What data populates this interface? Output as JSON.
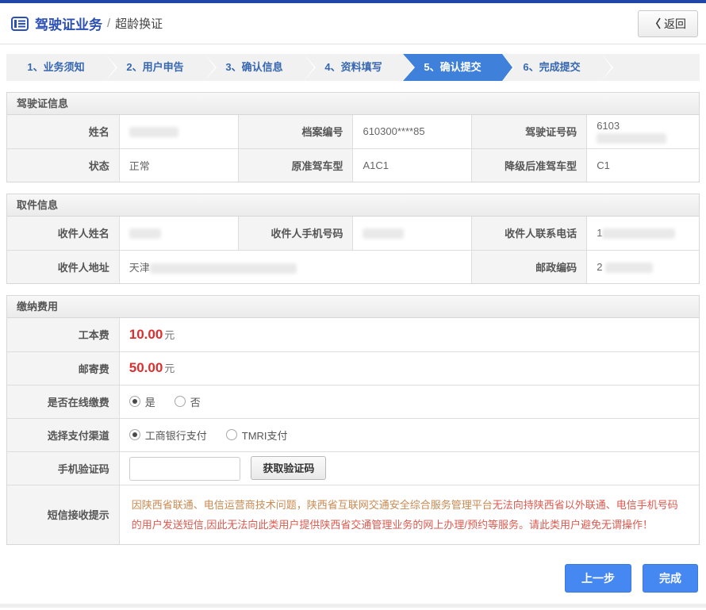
{
  "colors": {
    "top_bar_navy": "#2246a8",
    "accent_blue": "#3f80da",
    "step_text_blue": "#3767b1",
    "fee_red": "#dd2f2f",
    "notice_orange": "#c98a52",
    "notice_red": "#dc5a50",
    "button_blue": "#4688f1"
  },
  "header": {
    "title": "驾驶证业务",
    "separator": "/",
    "subtitle": "超龄换证",
    "back_chevron": "〈",
    "back_label": "返回"
  },
  "steps": [
    {
      "label": "1、业务须知",
      "active": false
    },
    {
      "label": "2、用户申告",
      "active": false
    },
    {
      "label": "3、确认信息",
      "active": false
    },
    {
      "label": "4、资料填写",
      "active": false
    },
    {
      "label": "5、确认提交",
      "active": true
    },
    {
      "label": "6、完成提交",
      "active": false
    }
  ],
  "license": {
    "title": "驾驶证信息",
    "name_label": "姓名",
    "file_no_label": "档案编号",
    "file_no_value": "610300****85",
    "license_no_label": "驾驶证号码",
    "license_no_value": "6103",
    "status_label": "状态",
    "status_value": "正常",
    "orig_class_label": "原准驾车型",
    "orig_class_value": "A1C1",
    "downgraded_class_label": "降级后准驾车型",
    "downgraded_class_value": "C1"
  },
  "pickup": {
    "title": "取件信息",
    "recipient_name_label": "收件人姓名",
    "recipient_mobile_label": "收件人手机号码",
    "recipient_phone_label": "收件人联系电话",
    "recipient_phone_value": "1",
    "recipient_address_label": "收件人地址",
    "recipient_address_value": "天津",
    "postal_code_label": "邮政编码",
    "postal_code_value": "2"
  },
  "payment": {
    "title": "缴纳费用",
    "work_fee_label": "工本费",
    "work_fee_value": "10.00",
    "mail_fee_label": "邮寄费",
    "mail_fee_value": "50.00",
    "fee_unit": "元",
    "online_pay_label": "是否在线缴费",
    "online_yes": "是",
    "online_no": "否",
    "online_pay_selected": "是",
    "channel_label": "选择支付渠道",
    "channel_icbc": "工商银行支付",
    "channel_tmri": "TMRI支付",
    "channel_selected": "工商银行支付",
    "sms_code_label": "手机验证码",
    "sms_code_value": "",
    "get_code_label": "获取验证码",
    "sms_notice_label": "短信接收提示",
    "notice_part1": "因陕西省联通、电信运营商技术问题，陕西省互联网交通安全综合服务管理平台",
    "notice_part2": "无法向持陕西省以外联通、电信手机号码的用户发送短信,因此无法向此类用户提供陕西省交通管理业务的网上办理/预约等服务。请此类用户避免无谓操作！"
  },
  "footer": {
    "prev_label": "上一步",
    "finish_label": "完成"
  }
}
